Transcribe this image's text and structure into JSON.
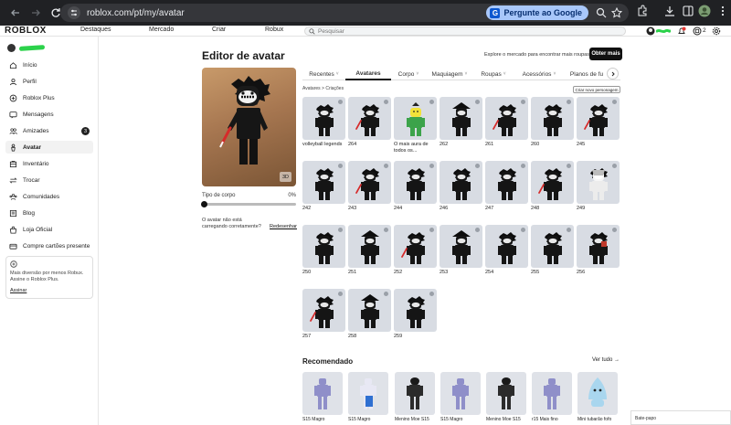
{
  "browser": {
    "url": "roblox.com/pt/my/avatar",
    "ask_google": "Pergunte ao Google"
  },
  "header": {
    "logo": "ROBLOX",
    "nav": [
      "Destaques",
      "Mercado",
      "Criar",
      "Robux"
    ],
    "search_placeholder": "Pesquisar",
    "robux_count": "2",
    "notif_count": "8"
  },
  "sidebar": {
    "items": [
      {
        "label": "Início",
        "icon": "home-icon"
      },
      {
        "label": "Perfil",
        "icon": "profile-icon"
      },
      {
        "label": "Roblox Plus",
        "icon": "plus-icon"
      },
      {
        "label": "Mensagens",
        "icon": "message-icon"
      },
      {
        "label": "Amizades",
        "icon": "friends-icon",
        "badge": "3"
      },
      {
        "label": "Avatar",
        "icon": "avatar-icon",
        "active": true
      },
      {
        "label": "Inventário",
        "icon": "inventory-icon"
      },
      {
        "label": "Trocar",
        "icon": "trade-icon"
      },
      {
        "label": "Comunidades",
        "icon": "groups-icon"
      },
      {
        "label": "Blog",
        "icon": "blog-icon"
      },
      {
        "label": "Loja Oficial",
        "icon": "store-icon"
      },
      {
        "label": "Compre cartões presente",
        "icon": "giftcard-icon"
      }
    ],
    "plus_card": {
      "text": "Mais diversão por menos Robux. Assine o Roblox Plus.",
      "link": "Assinar"
    }
  },
  "main": {
    "title": "Editor de avatar",
    "explore_text": "Explore o mercado para encontrar mais roupas!",
    "get_more": "Obter mais",
    "btn_3d": "3D",
    "body_type_label": "Tipo de corpo",
    "body_type_value": "0%",
    "body_type_fraction": 0,
    "not_loading": "O avatar não está carregando corretamente?",
    "redraw": "Redesenhar",
    "tabs": [
      "Recentes",
      "Avatares",
      "Corpo",
      "Maquiagem",
      "Roupas",
      "Acessórios",
      "Planos de fu"
    ],
    "active_tab": 1,
    "breadcrumb": "Avatares > Criações",
    "create_button": "Criar novo personagem",
    "items": [
      {
        "label": "volleyball legends",
        "kind": "black"
      },
      {
        "label": "264",
        "kind": "knife"
      },
      {
        "label": "O mais aura de todos os...",
        "kind": "yellow"
      },
      {
        "label": "262",
        "kind": "hat"
      },
      {
        "label": "261",
        "kind": "knife"
      },
      {
        "label": "260",
        "kind": "black"
      },
      {
        "label": "245",
        "kind": "knife"
      },
      {
        "label": "242",
        "kind": "black"
      },
      {
        "label": "243",
        "kind": "knife"
      },
      {
        "label": "244",
        "kind": "black"
      },
      {
        "label": "246",
        "kind": "black"
      },
      {
        "label": "247",
        "kind": "black"
      },
      {
        "label": "248",
        "kind": "knife"
      },
      {
        "label": "249",
        "kind": "white"
      },
      {
        "label": "250",
        "kind": "black"
      },
      {
        "label": "251",
        "kind": "hat"
      },
      {
        "label": "252",
        "kind": "knife"
      },
      {
        "label": "253",
        "kind": "hat"
      },
      {
        "label": "254",
        "kind": "black"
      },
      {
        "label": "255",
        "kind": "black"
      },
      {
        "label": "256",
        "kind": "red"
      },
      {
        "label": "257",
        "kind": "knife"
      },
      {
        "label": "258",
        "kind": "hat"
      },
      {
        "label": "259",
        "kind": "black"
      }
    ],
    "recommended_title": "Recomendado",
    "see_all": "Ver tudo →",
    "recommended": [
      {
        "label": "S15 Magro",
        "kind": "purple"
      },
      {
        "label": "S15 Magro",
        "kind": "blue"
      },
      {
        "label": "Menino Moe S15",
        "kind": "moe"
      },
      {
        "label": "S15 Magro",
        "kind": "purple"
      },
      {
        "label": "Menino Moe S15",
        "kind": "moe"
      },
      {
        "label": "r15 Mais fino",
        "kind": "purple"
      },
      {
        "label": "Mini tubarão fofo",
        "kind": "shark"
      }
    ],
    "chat": "Bate-papo"
  },
  "colors": {
    "accent": "#111111",
    "chrome": "#202124",
    "tile": "#d8dce3",
    "username_scribble": "#2cd24b"
  }
}
